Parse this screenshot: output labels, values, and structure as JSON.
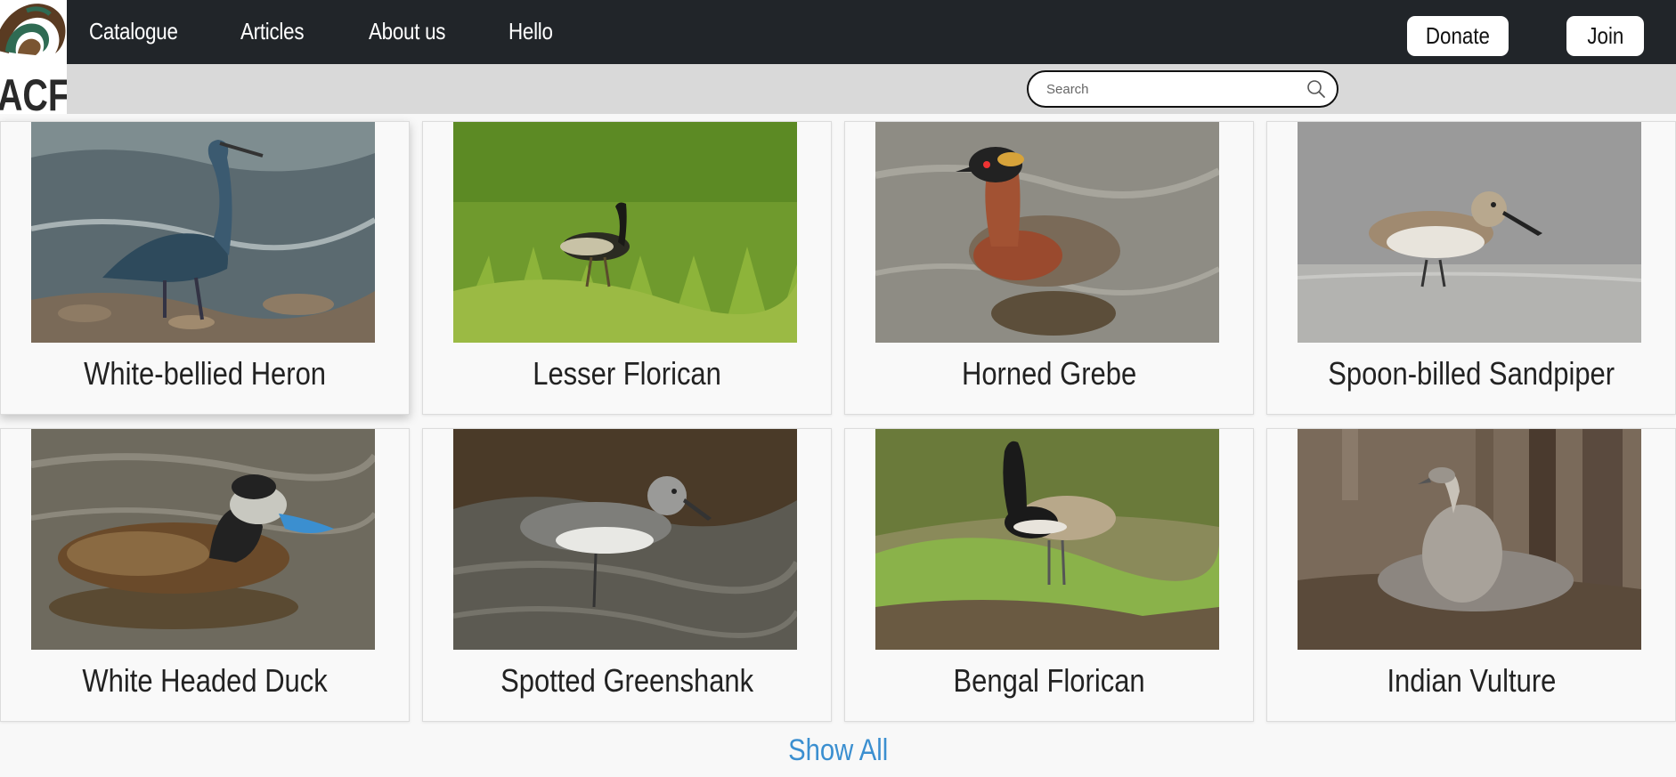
{
  "brand": {
    "logo_text": "IACF"
  },
  "nav": {
    "links": [
      {
        "label": "Catalogue"
      },
      {
        "label": "Articles"
      },
      {
        "label": "About us"
      },
      {
        "label": "Hello"
      }
    ],
    "donate_label": "Donate",
    "join_label": "Join"
  },
  "search": {
    "placeholder": "Search"
  },
  "birds": [
    {
      "name": "White-bellied Heron"
    },
    {
      "name": "Lesser Florican"
    },
    {
      "name": "Horned Grebe"
    },
    {
      "name": "Spoon-billed Sandpiper"
    },
    {
      "name": "White Headed Duck"
    },
    {
      "name": "Spotted Greenshank"
    },
    {
      "name": "Bengal Florican"
    },
    {
      "name": "Indian Vulture"
    }
  ],
  "show_all_label": "Show All",
  "colors": {
    "nav_bg": "#212529",
    "search_strip": "#d9d9d9",
    "link": "#3b8fd0"
  }
}
